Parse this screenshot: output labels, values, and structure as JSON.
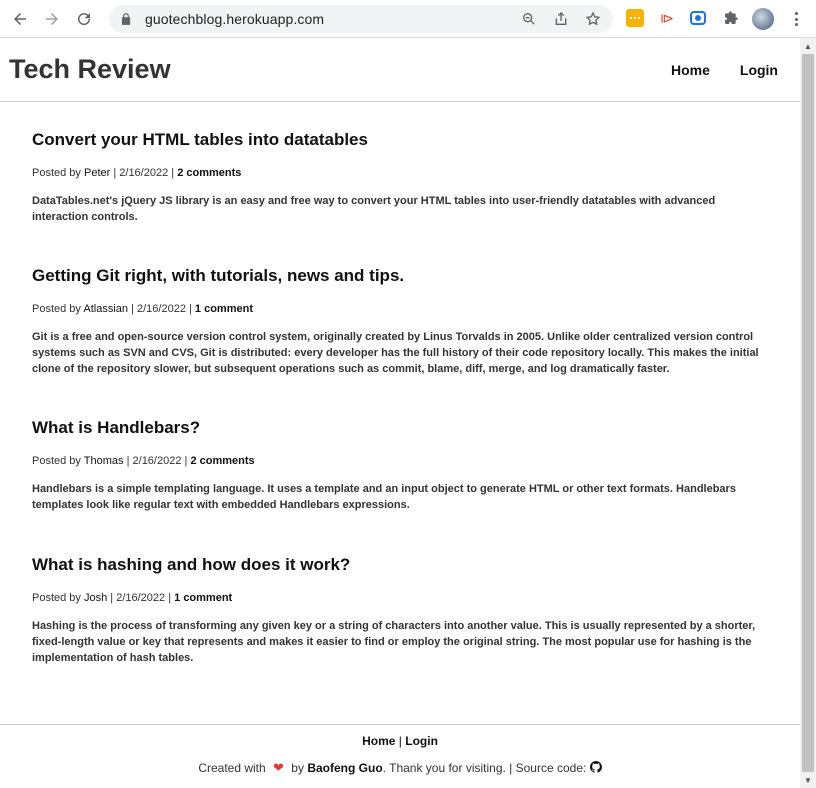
{
  "browser": {
    "url": "guotechblog.herokuapp.com"
  },
  "header": {
    "brand": "Tech Review",
    "nav": [
      {
        "label": "Home"
      },
      {
        "label": "Login"
      }
    ]
  },
  "posts": [
    {
      "title": "Convert your HTML tables into datatables",
      "posted_by": "Posted by",
      "author": "Peter",
      "date": "2/16/2022",
      "comments": "2 comments",
      "excerpt": "DataTables.net's jQuery JS library is an easy and free way to convert your HTML tables into user-friendly datatables with advanced interaction controls."
    },
    {
      "title": "Getting Git right, with tutorials, news and tips.",
      "posted_by": "Posted by",
      "author": "Atlassian",
      "date": "2/16/2022",
      "comments": "1 comment",
      "excerpt": "Git is a free and open-source version control system, originally created by Linus Torvalds in 2005. Unlike older centralized version control systems such as SVN and CVS, Git is distributed: every developer has the full history of their code repository locally. This makes the initial clone of the repository slower, but subsequent operations such as commit, blame, diff, merge, and log dramatically faster."
    },
    {
      "title": "What is Handlebars?",
      "posted_by": "Posted by",
      "author": "Thomas",
      "date": "2/16/2022",
      "comments": "2 comments",
      "excerpt": "Handlebars is a simple templating language. It uses a template and an input object to generate HTML or other text formats. Handlebars templates look like regular text with embedded Handlebars expressions."
    },
    {
      "title": "What is hashing and how does it work?",
      "posted_by": "Posted by",
      "author": "Josh",
      "date": "2/16/2022",
      "comments": "1 comment",
      "excerpt": "Hashing is the process of transforming any given key or a string of characters into another value. This is usually represented by a shorter, fixed-length value or key that represents and makes it easier to find or employ the original string. The most popular use for hashing is the implementation of hash tables."
    }
  ],
  "footer": {
    "links": [
      {
        "label": "Home"
      },
      {
        "label": "Login"
      }
    ],
    "separator": "|",
    "created_with": "Created with",
    "by": "by",
    "author": "Baofeng Guo",
    "thanks": ". Thank you for visiting. | Source code:",
    "heart_icon": "heart-icon",
    "source_icon": "github-icon"
  }
}
